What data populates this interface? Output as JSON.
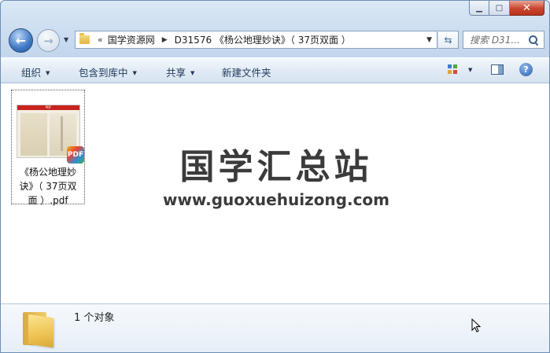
{
  "window": {
    "caption": {
      "minimize_glyph": "▁",
      "maximize_glyph": "□",
      "close_glyph": "✕"
    }
  },
  "nav": {
    "back_glyph": "←",
    "forward_glyph": "→",
    "dropdown_glyph": "▼"
  },
  "address": {
    "overflow_glyph": "«",
    "segments": [
      "国学资源网",
      "D31576 《杨公地理妙诀》（ 37页双面 ）"
    ],
    "separator_glyph": "▶",
    "dropdown_glyph": "▼"
  },
  "refresh_glyph": "⇆",
  "search": {
    "placeholder": "搜索 D31..."
  },
  "toolbar": {
    "organize": "组织",
    "include_in_library": "包含到库中",
    "share": "共享",
    "new_folder": "新建文件夹",
    "dropdown_glyph": "▼",
    "help_glyph": "?"
  },
  "file": {
    "thumb_header": "PDF",
    "badge": "PDF",
    "name_lines": [
      "《杨公地理妙",
      "诀》（ 37页双",
      "面 ）.pdf"
    ]
  },
  "watermark": {
    "title": "国学汇总站",
    "url": "www.guoxuehuizong.com"
  },
  "details": {
    "count_text": "1 个对象"
  },
  "colors": {
    "accent": "#3d77c3",
    "close_button": "#c9452e",
    "window_border": "#6d8fb5",
    "pdf_red": "#c8231f"
  }
}
